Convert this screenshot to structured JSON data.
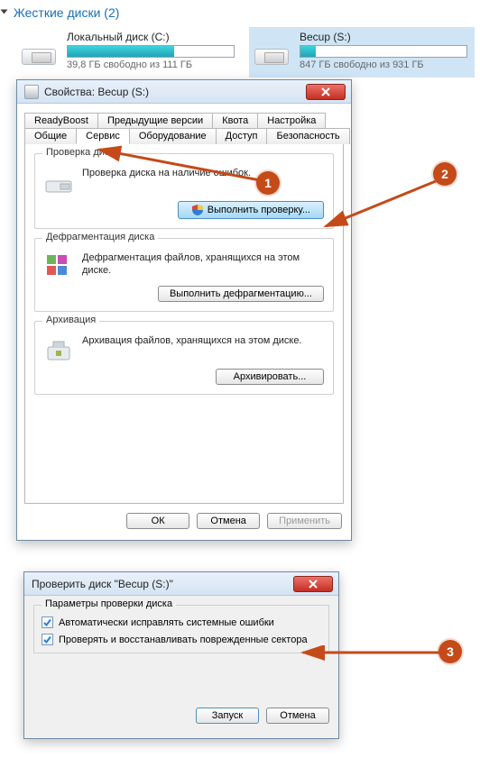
{
  "header": {
    "title": "Жесткие диски (2)"
  },
  "drives": [
    {
      "title": "Локальный диск (С:)",
      "free": "39,8 ГБ свободно из 111 ГБ",
      "fill_pct": 64,
      "selected": false
    },
    {
      "title": "Becup (S:)",
      "free": "847 ГБ свободно из 931 ГБ",
      "fill_pct": 9,
      "selected": true
    }
  ],
  "dialog": {
    "title": "Свойства: Becup (S:)",
    "tabs_row1": [
      "ReadyBoost",
      "Предыдущие версии",
      "Квота",
      "Настройка"
    ],
    "tabs_row2": [
      "Общие",
      "Сервис",
      "Оборудование",
      "Доступ",
      "Безопасность"
    ],
    "active_tab": "Сервис",
    "groups": {
      "check": {
        "title": "Проверка диска",
        "desc": "Проверка диска на наличие ошибок.",
        "button": "Выполнить проверку..."
      },
      "defrag": {
        "title": "Дефрагментация диска",
        "desc": "Дефрагментация файлов, хранящихся на этом диске.",
        "button": "Выполнить дефрагментацию..."
      },
      "backup": {
        "title": "Архивация",
        "desc": "Архивация файлов, хранящихся на этом диске.",
        "button": "Архивировать..."
      }
    },
    "buttons": {
      "ok": "ОК",
      "cancel": "Отмена",
      "apply": "Применить"
    }
  },
  "check_dialog": {
    "title": "Проверить диск \"Becup (S:)\"",
    "group_title": "Параметры проверки диска",
    "opt1": "Автоматически исправлять системные ошибки",
    "opt2": "Проверять и восстанавливать поврежденные сектора",
    "start": "Запуск",
    "cancel": "Отмена"
  },
  "callouts": {
    "n1": "1",
    "n2": "2",
    "n3": "3"
  }
}
